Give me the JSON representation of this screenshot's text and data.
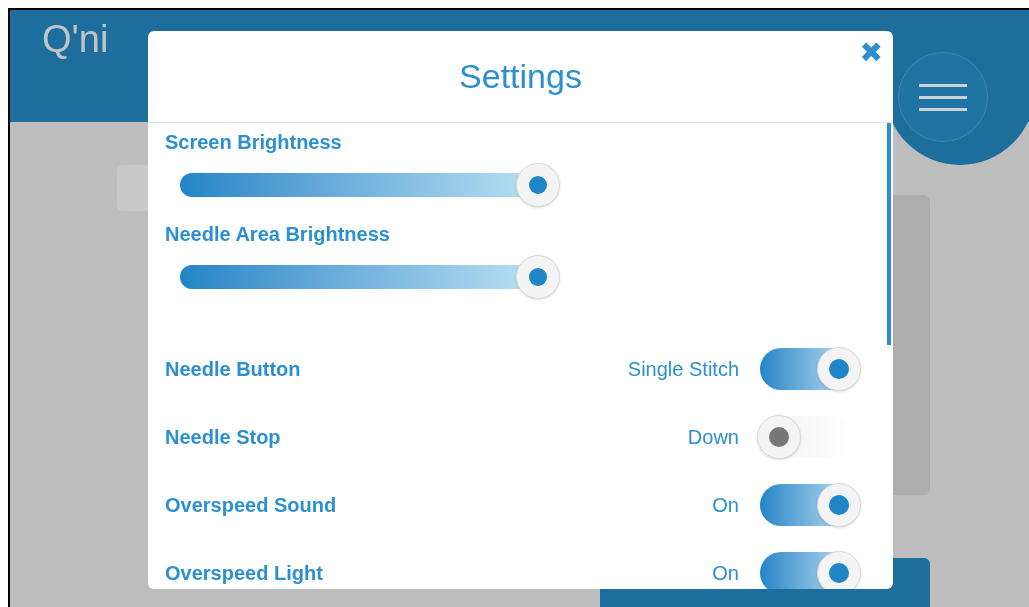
{
  "app": {
    "logo": "Q'ni"
  },
  "dialog": {
    "title": "Settings",
    "close": "✖"
  },
  "sliders": [
    {
      "label": "Screen Brightness",
      "level": 1
    },
    {
      "label": "Needle Area Brightness",
      "level": 1
    }
  ],
  "toggles": [
    {
      "label": "Needle Button",
      "value": "Single Stitch",
      "on": true
    },
    {
      "label": "Needle Stop",
      "value": "Down",
      "on": false
    },
    {
      "label": "Overspeed Sound",
      "value": "On",
      "on": true
    },
    {
      "label": "Overspeed Light",
      "value": "On",
      "on": true
    }
  ]
}
